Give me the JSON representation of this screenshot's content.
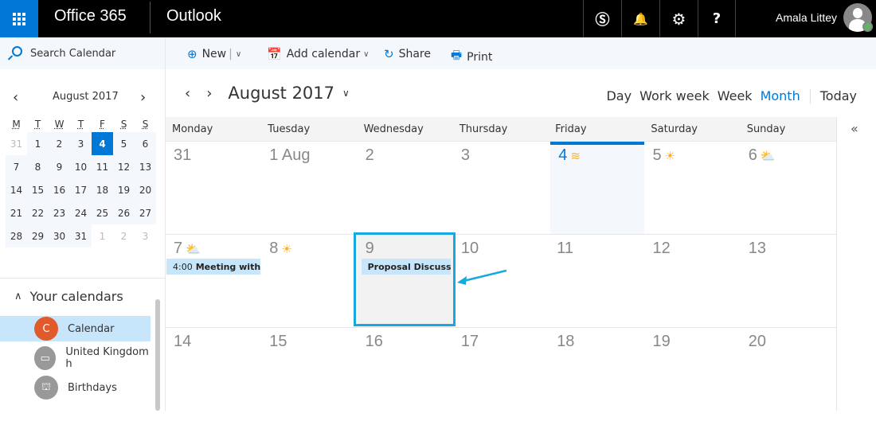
{
  "topbar": {
    "brand": "Office 365",
    "app_name": "Outlook",
    "icons": [
      "skype-icon",
      "bell-icon",
      "gear-icon",
      "help-icon"
    ],
    "skype_glyph": "Ⓢ",
    "bell_glyph": "🔔",
    "gear_glyph": "⚙",
    "help_glyph": "?",
    "user_name": "Amala Littey",
    "presence": "available"
  },
  "commands": {
    "search_placeholder": "Search Calendar",
    "new_label": "New",
    "add_calendar_label": "Add calendar",
    "share_label": "Share",
    "print_label": "Print"
  },
  "mini_calendar": {
    "title": "August 2017",
    "dow": [
      "M",
      "T",
      "W",
      "T",
      "F",
      "S",
      "S"
    ],
    "weeks": [
      [
        {
          "d": "31",
          "s": "out0"
        },
        {
          "d": "1",
          "s": "in"
        },
        {
          "d": "2",
          "s": "in"
        },
        {
          "d": "3",
          "s": "in"
        },
        {
          "d": "4",
          "s": "today"
        },
        {
          "d": "5",
          "s": "in"
        },
        {
          "d": "6",
          "s": "in"
        }
      ],
      [
        {
          "d": "7",
          "s": "in"
        },
        {
          "d": "8",
          "s": "in"
        },
        {
          "d": "9",
          "s": "in"
        },
        {
          "d": "10",
          "s": "in"
        },
        {
          "d": "11",
          "s": "in"
        },
        {
          "d": "12",
          "s": "in"
        },
        {
          "d": "13",
          "s": "in"
        }
      ],
      [
        {
          "d": "14",
          "s": "in"
        },
        {
          "d": "15",
          "s": "in"
        },
        {
          "d": "16",
          "s": "in"
        },
        {
          "d": "17",
          "s": "in"
        },
        {
          "d": "18",
          "s": "in"
        },
        {
          "d": "19",
          "s": "in"
        },
        {
          "d": "20",
          "s": "in"
        }
      ],
      [
        {
          "d": "21",
          "s": "in"
        },
        {
          "d": "22",
          "s": "in"
        },
        {
          "d": "23",
          "s": "in"
        },
        {
          "d": "24",
          "s": "in"
        },
        {
          "d": "25",
          "s": "in"
        },
        {
          "d": "26",
          "s": "in"
        },
        {
          "d": "27",
          "s": "in"
        }
      ],
      [
        {
          "d": "28",
          "s": "in"
        },
        {
          "d": "29",
          "s": "in"
        },
        {
          "d": "30",
          "s": "in"
        },
        {
          "d": "31",
          "s": "in"
        },
        {
          "d": "1",
          "s": "out"
        },
        {
          "d": "2",
          "s": "out"
        },
        {
          "d": "3",
          "s": "out"
        }
      ]
    ]
  },
  "calendars": {
    "section_label": "Your calendars",
    "items": [
      {
        "label": "Calendar",
        "initial": "C",
        "color": "#e05a2b",
        "selected": true
      },
      {
        "label": "United Kingdom h",
        "initial": "▭",
        "color": "#999999",
        "selected": false
      },
      {
        "label": "Birthdays",
        "initial": "⛫",
        "color": "#999999",
        "selected": false
      }
    ]
  },
  "main": {
    "title": "August 2017",
    "views": [
      "Day",
      "Work week",
      "Week",
      "Month"
    ],
    "active_view": "Month",
    "today_label": "Today",
    "days_of_week": [
      "Monday",
      "Tuesday",
      "Wednesday",
      "Thursday",
      "Friday",
      "Saturday",
      "Sunday"
    ],
    "weeks": [
      [
        {
          "n": "31"
        },
        {
          "n": "1 Aug"
        },
        {
          "n": "2"
        },
        {
          "n": "3"
        },
        {
          "n": "4",
          "today": true,
          "wx": "≋"
        },
        {
          "n": "5",
          "wx": "☀"
        },
        {
          "n": "6",
          "wx": "⛅"
        }
      ],
      [
        {
          "n": "7",
          "wx": "⛅",
          "event": {
            "time": "4:00",
            "title": "Meeting with"
          }
        },
        {
          "n": "8",
          "wx": "☀"
        },
        {
          "n": "9",
          "selected": true,
          "event": {
            "time": "",
            "title": "Proposal Discussic"
          }
        },
        {
          "n": "10"
        },
        {
          "n": "11"
        },
        {
          "n": "12"
        },
        {
          "n": "13"
        }
      ],
      [
        {
          "n": "14"
        },
        {
          "n": "15"
        },
        {
          "n": "16"
        },
        {
          "n": "17"
        },
        {
          "n": "18"
        },
        {
          "n": "19"
        },
        {
          "n": "20"
        }
      ]
    ]
  },
  "colors": {
    "accent": "#0078d7",
    "highlight": "#16a9e1",
    "event_bg": "#c7e6fb"
  }
}
